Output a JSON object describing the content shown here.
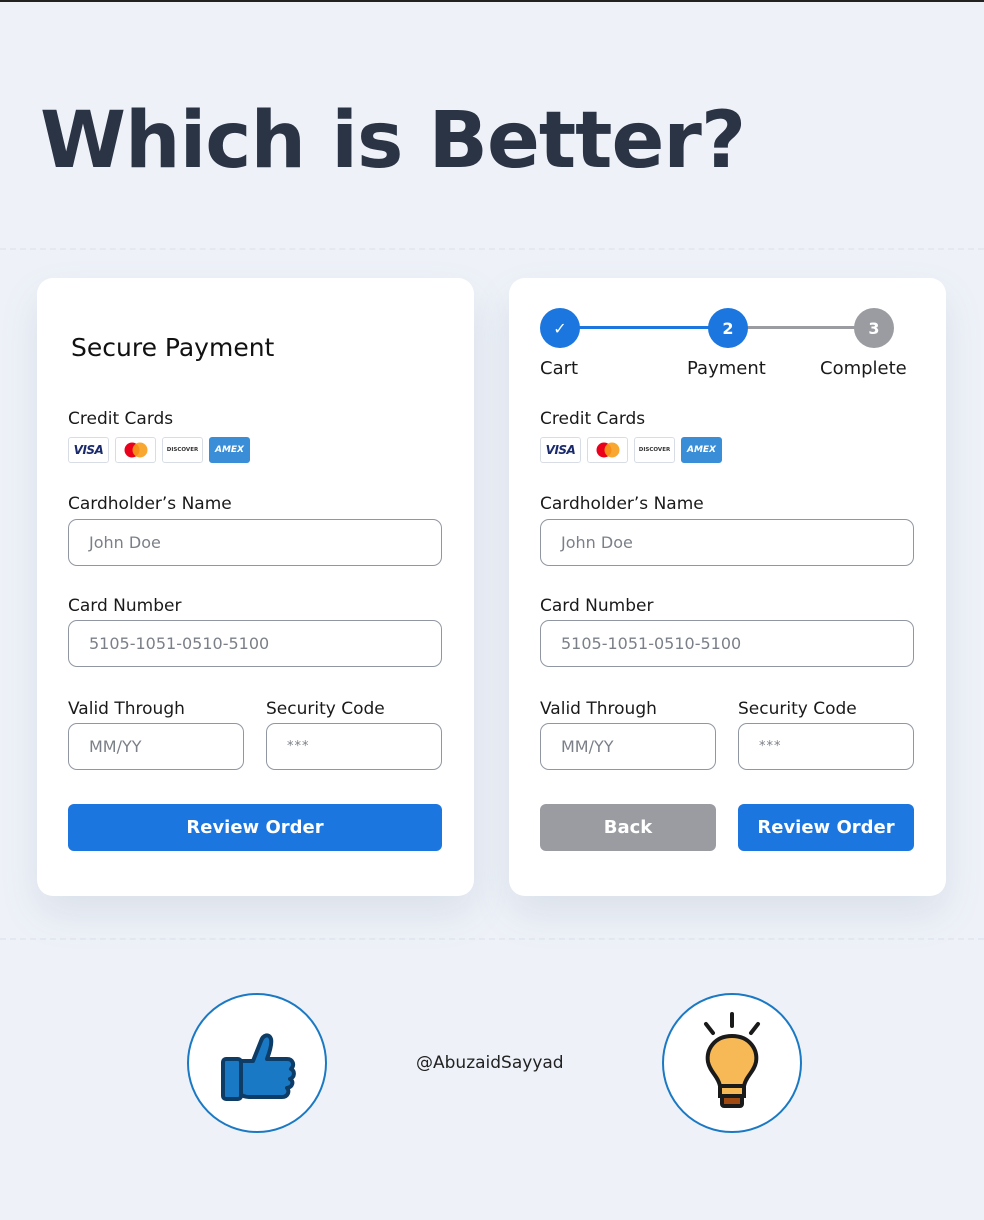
{
  "heading": "Which is Better?",
  "left_card": {
    "title": "Secure Payment",
    "credit_cards_label": "Credit Cards",
    "card_brands": [
      "VISA",
      "mastercard",
      "DISCOVER",
      "AMEX"
    ],
    "name_label": "Cardholder’s Name",
    "name_placeholder": "John Doe",
    "number_label": "Card Number",
    "number_placeholder": "5105-1051-0510-5100",
    "valid_label": "Valid Through",
    "valid_placeholder": "MM/YY",
    "security_label": "Security Code",
    "security_placeholder": "***",
    "review_button": "Review Order"
  },
  "right_card": {
    "steps": [
      {
        "label": "Cart",
        "marker": "✓",
        "state": "done"
      },
      {
        "label": "Payment",
        "marker": "2",
        "state": "current"
      },
      {
        "label": "Complete",
        "marker": "3",
        "state": "todo"
      }
    ],
    "credit_cards_label": "Credit Cards",
    "card_brands": [
      "VISA",
      "mastercard",
      "DISCOVER",
      "AMEX"
    ],
    "name_label": "Cardholder’s Name",
    "name_placeholder": "John Doe",
    "number_label": "Card Number",
    "number_placeholder": "5105-1051-0510-5100",
    "valid_label": "Valid Through",
    "valid_placeholder": "MM/YY",
    "security_label": "Security Code",
    "security_placeholder": "***",
    "back_button": "Back",
    "review_button": "Review Order"
  },
  "handle": "@AbuzaidSayyad",
  "icons": {
    "left_bubble": "thumbs-up-icon",
    "right_bubble": "lightbulb-icon"
  },
  "colors": {
    "primary": "#1b76df",
    "secondary_button": "#9a9ca1",
    "heading": "#2b3444",
    "background": "#eef2f8"
  }
}
